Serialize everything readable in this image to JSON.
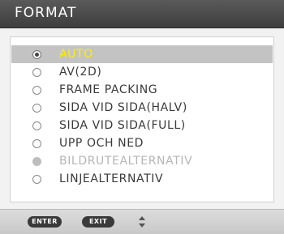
{
  "title": "FORMAT",
  "options": [
    {
      "label": "AUTO",
      "state": "selected"
    },
    {
      "label": "AV(2D)",
      "state": "normal"
    },
    {
      "label": "FRAME PACKING",
      "state": "normal"
    },
    {
      "label": "SIDA VID SIDA(HALV)",
      "state": "normal"
    },
    {
      "label": "SIDA VID SIDA(FULL)",
      "state": "normal"
    },
    {
      "label": "UPP OCH NED",
      "state": "normal"
    },
    {
      "label": "BILDRUTEALTERNATIV",
      "state": "disabled"
    },
    {
      "label": "LINJEALTERNATIV",
      "state": "normal"
    }
  ],
  "footer": {
    "enter_label": "ENTER",
    "exit_label": "EXIT",
    "updown_icon": "up-down-arrows-icon"
  },
  "colors": {
    "highlight_text": "#ffef00",
    "highlight_bg": "#c3c3c3",
    "disabled_text": "#b5b5b5",
    "title_bar": "#4a4a4a"
  }
}
